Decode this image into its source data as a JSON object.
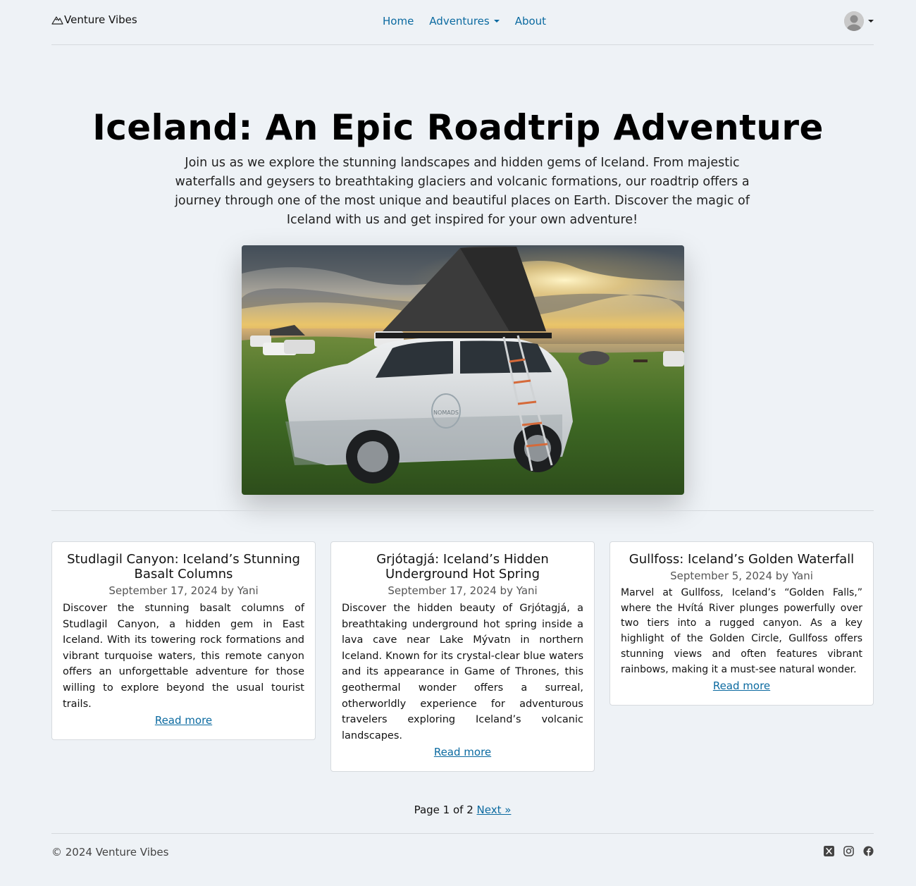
{
  "header": {
    "brand": "Venture Vibes",
    "nav": {
      "home": "Home",
      "adventures": "Adventures",
      "about": "About"
    }
  },
  "hero": {
    "title": "Iceland: An Epic Roadtrip Adventure",
    "lead": "Join us as we explore the stunning landscapes and hidden gems of Iceland. From majestic waterfalls and geysers to breathtaking glaciers and volcanic formations, our roadtrip offers a journey through one of the most unique and beautiful places on Earth. Discover the magic of Iceland with us and get inspired for your own adventure!",
    "image_text": "NOMADS"
  },
  "posts": [
    {
      "title": "Studlagil Canyon: Iceland’s Stunning Basalt Columns",
      "meta": "September 17, 2024 by Yani",
      "excerpt": "Discover the stunning basalt columns of Studlagil Canyon, a hidden gem in East Iceland. With its towering rock formations and vibrant turquoise waters, this remote canyon offers an unforgettable adventure for those willing to explore beyond the usual tourist trails.",
      "link": "Read more"
    },
    {
      "title": "Grjótagjá: Iceland’s Hidden Underground Hot Spring",
      "meta": "September 17, 2024 by Yani",
      "excerpt": "Discover the hidden beauty of Grjótagjá, a breathtaking underground hot spring inside a lava cave near Lake Mývatn in northern Iceland. Known for its crystal-clear blue waters and its appearance in Game of Thrones, this geothermal wonder offers a surreal, otherworldly experience for adventurous travelers exploring Iceland’s volcanic landscapes.",
      "link": "Read more"
    },
    {
      "title": "Gullfoss: Iceland’s Golden Waterfall",
      "meta": "September 5, 2024 by Yani",
      "excerpt": "Marvel at Gullfoss, Iceland’s “Golden Falls,” where the Hvítá River plunges powerfully over two tiers into a rugged canyon. As a key highlight of the Golden Circle, Gullfoss offers stunning views and often features vibrant rainbows, making it a must-see natural wonder.",
      "link": "Read more"
    }
  ],
  "pagination": {
    "status": "Page 1 of 2",
    "next": "Next »"
  },
  "footer": {
    "copyright": "© 2024 Venture Vibes",
    "social_icons": [
      "x-icon",
      "instagram-icon",
      "facebook-icon"
    ]
  },
  "colors": {
    "page_bg": "#eef2f6",
    "link": "#0b6aa0",
    "card_bg": "#ffffff",
    "divider": "#d5d9dd"
  }
}
